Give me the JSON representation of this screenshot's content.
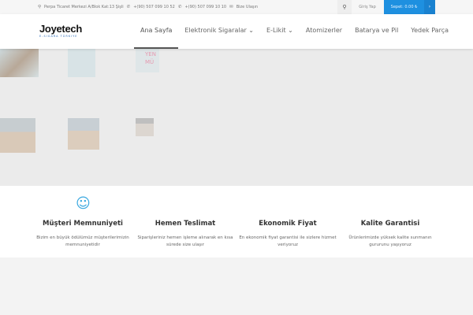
{
  "topbar": {
    "address": "Perpa Ticaret Merkezi A/Blok Kat:13 Şişli",
    "phone1": "+(90) 507 099 10 52",
    "phone2": "+(90) 507 099 10 10",
    "contact": "Bize Ulaşın",
    "login": "Giriş Yap",
    "cart": "Sepet: 0.00 ₺"
  },
  "logo": {
    "name": "Joyetech",
    "sub": "E-SIGARA TÜRKIYE"
  },
  "nav": [
    {
      "label": "Ana Sayfa",
      "active": true
    },
    {
      "label": "Elektronik Sigaralar ⌄"
    },
    {
      "label": "E-Likit ⌄"
    },
    {
      "label": "Atomizerler"
    },
    {
      "label": "Batarya ve Pil"
    },
    {
      "label": "Yedek Parça"
    }
  ],
  "slider": {
    "fragment_text": "YEN\nMÜ"
  },
  "features": [
    {
      "title": "Müşteri Memnuniyeti",
      "text": "Bizim en büyük ödülümüz müşterilerimizin memnuniyetidir",
      "icon": "smile-icon"
    },
    {
      "title": "Hemen Teslimat",
      "text": "Siparişleriniz hemen işleme alınarak en kısa sürede size ulaşır"
    },
    {
      "title": "Ekonomik Fiyat",
      "text": "En ekonomik fiyat garantisi ile sizlere hizmet veriyoruz"
    },
    {
      "title": "Kalite Garantisi",
      "text": "Ürünlerimizde yüksek kalite sunmanın gururunu yaşıyoruz"
    }
  ],
  "colors": {
    "accent": "#1e90e0",
    "icon": "#3aa8e0"
  }
}
